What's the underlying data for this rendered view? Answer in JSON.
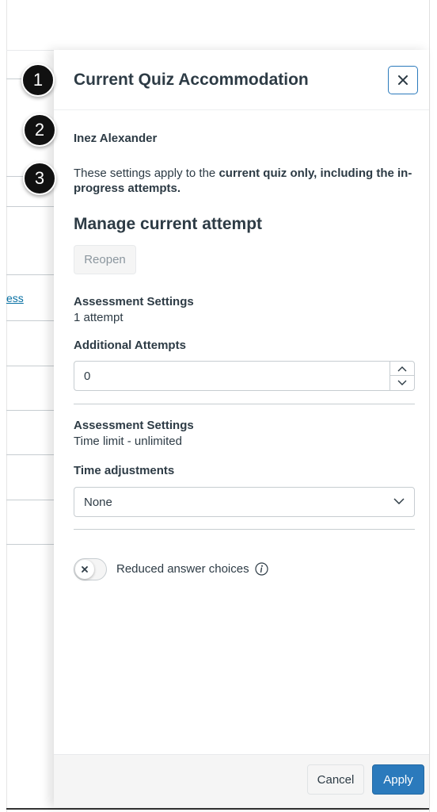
{
  "background": {
    "link_text": "ess"
  },
  "tray": {
    "title": "Current Quiz Accommodation",
    "close_label": "Close",
    "student_name": "Inez Alexander",
    "description_prefix": "These settings apply to the ",
    "description_bold": "current quiz only, including the in-progress attempts.",
    "manage_title": "Manage current attempt",
    "reopen_label": "Reopen",
    "attempts_section": {
      "heading": "Assessment Settings",
      "value": "1 attempt",
      "field_label": "Additional Attempts",
      "field_value": "0"
    },
    "time_section": {
      "heading": "Assessment Settings",
      "value": "Time limit - unlimited",
      "field_label": "Time adjustments",
      "selected": "None"
    },
    "reduced_choices_label": "Reduced answer choices",
    "footer": {
      "cancel_label": "Cancel",
      "apply_label": "Apply"
    }
  },
  "markers": [
    "1",
    "2",
    "3"
  ],
  "colors": {
    "accent": "#2b7abc",
    "text": "#2d3b45",
    "marker": "#111111"
  }
}
